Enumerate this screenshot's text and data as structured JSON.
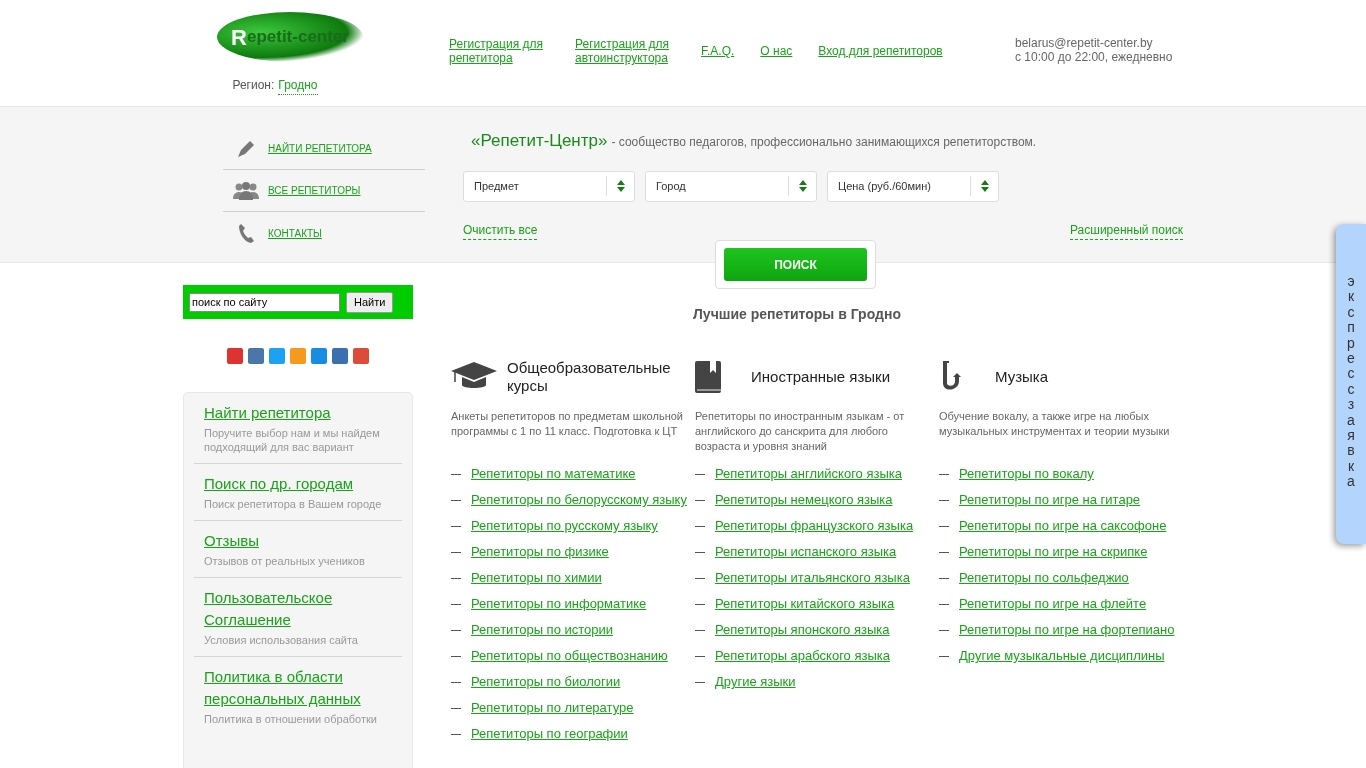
{
  "header": {
    "logo_text": "Repetit-center",
    "region": {
      "label": "Регион:",
      "value": "Гродно"
    },
    "nav": [
      "Регистрация для репетитора",
      "Регистрация для автоинструктора",
      "F.A.Q.",
      "О нас",
      "Вход для репетиторов"
    ],
    "contact": {
      "email": "belarus@repetit-center.by",
      "hours": "с 10:00 до 22:00, ежедневно"
    }
  },
  "side_menu": [
    "НАЙТИ РЕПЕТИТОРА",
    "ВСЕ РЕПЕТИТОРЫ",
    "КОНТАКТЫ"
  ],
  "tagline": {
    "brand": "«Репетит-Центр»",
    "text": "- сообщество педагогов, профессионально занимающихся репетиторством."
  },
  "filters": [
    "Предмет",
    "Город",
    "Цена (руб./60мин)"
  ],
  "clear_link": "Очистить все",
  "advanced_link": "Расширенный поиск",
  "search_button": "ПОИСК",
  "site_search": {
    "value": "поиск по сайту",
    "button": "Найти"
  },
  "info_panel": [
    {
      "title": "Найти репетитора",
      "description": "Поручите выбор нам и мы найдем подходящий для вас вариант"
    },
    {
      "title": "Поиск по др. городам",
      "description": "Поиск репетитора в Вашем городе"
    },
    {
      "title": "Отзывы",
      "description": "Отзывов от реальных учеников"
    },
    {
      "title": "Пользовательское Соглашение",
      "description": "Условия использования сайта"
    },
    {
      "title": "Политика в области персональных данных",
      "description": "Политика в отношении обработки"
    }
  ],
  "heading": "Лучшие репетиторы в Гродно",
  "categories": [
    {
      "title": "Общеобразовательные курсы",
      "description": "Анкеты репетиторов по предметам школьной программы с 1 по 11 класс. Подготовка к ЦТ",
      "links": [
        "Репетиторы по математике",
        "Репетиторы по белорусскому языку",
        "Репетиторы по русскому языку",
        "Репетиторы по физике",
        "Репетиторы по химии",
        "Репетиторы по информатике",
        "Репетиторы по истории",
        "Репетиторы по обществознанию",
        "Репетиторы по биологии",
        "Репетиторы по литературе",
        "Репетиторы по географии"
      ]
    },
    {
      "title": "Иностранные языки",
      "description": "Репетиторы по иностранным языкам - от английского до санскрита для любого возраста и уровня знаний",
      "links": [
        "Репетиторы английского языка",
        "Репетиторы немецкого языка",
        "Репетиторы французского языка",
        "Репетиторы испанского языка",
        "Репетиторы итальянского языка",
        "Репетиторы китайского языка",
        "Репетиторы японского языка",
        "Репетиторы арабского языка",
        "Другие языки"
      ]
    },
    {
      "title": "Музыка",
      "description": "Обучение вокалу, а также игре на любых музыкальных инструментах и теории музыки",
      "links": [
        "Репетиторы по вокалу",
        "Репетиторы по игре на гитаре",
        "Репетиторы по игре на саксофоне",
        "Репетиторы по игре на скрипке",
        "Репетиторы по сольфеджио",
        "Репетиторы по игре на флейте",
        "Репетиторы по игре на фортепиано",
        "Другие музыкальные дисциплины"
      ]
    }
  ],
  "express_tab": {
    "label": "экспресс заявка"
  }
}
